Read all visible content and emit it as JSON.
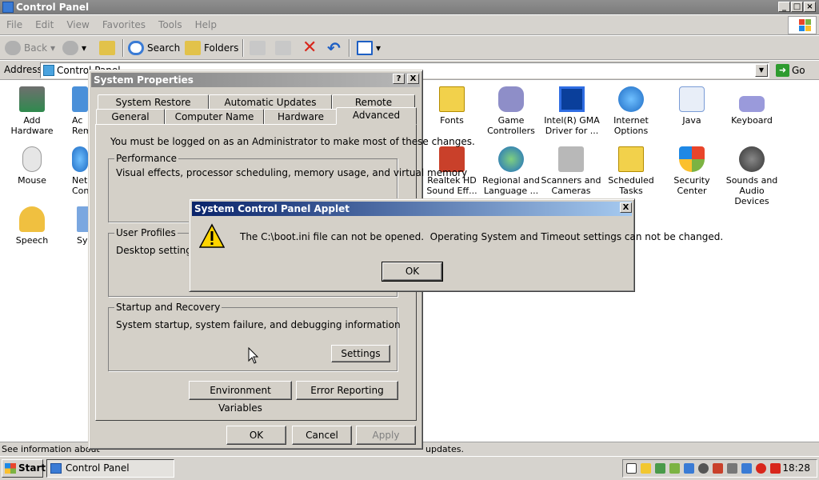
{
  "window": {
    "title": "Control Panel",
    "menu": [
      "File",
      "Edit",
      "View",
      "Favorites",
      "Tools",
      "Help"
    ],
    "toolbar": {
      "back": "Back",
      "search": "Search",
      "folders": "Folders"
    },
    "address": {
      "label": "Address",
      "value": "Control Panel",
      "go": "Go"
    }
  },
  "icons": [
    {
      "label": "Add Hardware"
    },
    {
      "label": "Fonts"
    },
    {
      "label": "Game Controllers"
    },
    {
      "label": "Intel(R) GMA Driver for ..."
    },
    {
      "label": "Internet Options"
    },
    {
      "label": "Java"
    },
    {
      "label": "Keyboard"
    },
    {
      "label": "Mouse"
    },
    {
      "label": "Realtek HD Sound Eff..."
    },
    {
      "label": "Regional and Language ..."
    },
    {
      "label": "Scanners and Cameras"
    },
    {
      "label": "Scheduled Tasks"
    },
    {
      "label": "Security Center"
    },
    {
      "label": "Sounds and Audio Devices"
    },
    {
      "label": "Speech"
    }
  ],
  "partial": {
    "ac": "Ac",
    "rem": "Rem",
    "net": "Net",
    "conn": "Conn",
    "sy": "Sy"
  },
  "status": {
    "left": "See information about",
    "right": "updates."
  },
  "sysprops": {
    "title": "System Properties",
    "help": "?",
    "close": "X",
    "tabs_row1": [
      "System Restore",
      "Automatic Updates",
      "Remote"
    ],
    "tabs_row2": [
      "General",
      "Computer Name",
      "Hardware",
      "Advanced"
    ],
    "admin_note": "You must be logged on as an Administrator to make most of these changes.",
    "performance": {
      "label": "Performance",
      "text": "Visual effects, processor scheduling, memory usage, and virtual memory"
    },
    "profiles": {
      "label": "User Profiles",
      "text": "Desktop settings re"
    },
    "startup": {
      "label": "Startup and Recovery",
      "text": "System startup, system failure, and debugging information",
      "button": "Settings"
    },
    "env_button": "Environment Variables",
    "error_button": "Error Reporting",
    "ok": "OK",
    "cancel": "Cancel",
    "apply": "Apply"
  },
  "applet": {
    "title": "System Control Panel Applet",
    "close": "X",
    "message": "The C:\\boot.ini file can not be opened.  Operating System and Timeout settings can not be changed.",
    "ok": "OK"
  },
  "taskbar": {
    "start": "Start",
    "task": "Control Panel",
    "clock": "18:28"
  }
}
